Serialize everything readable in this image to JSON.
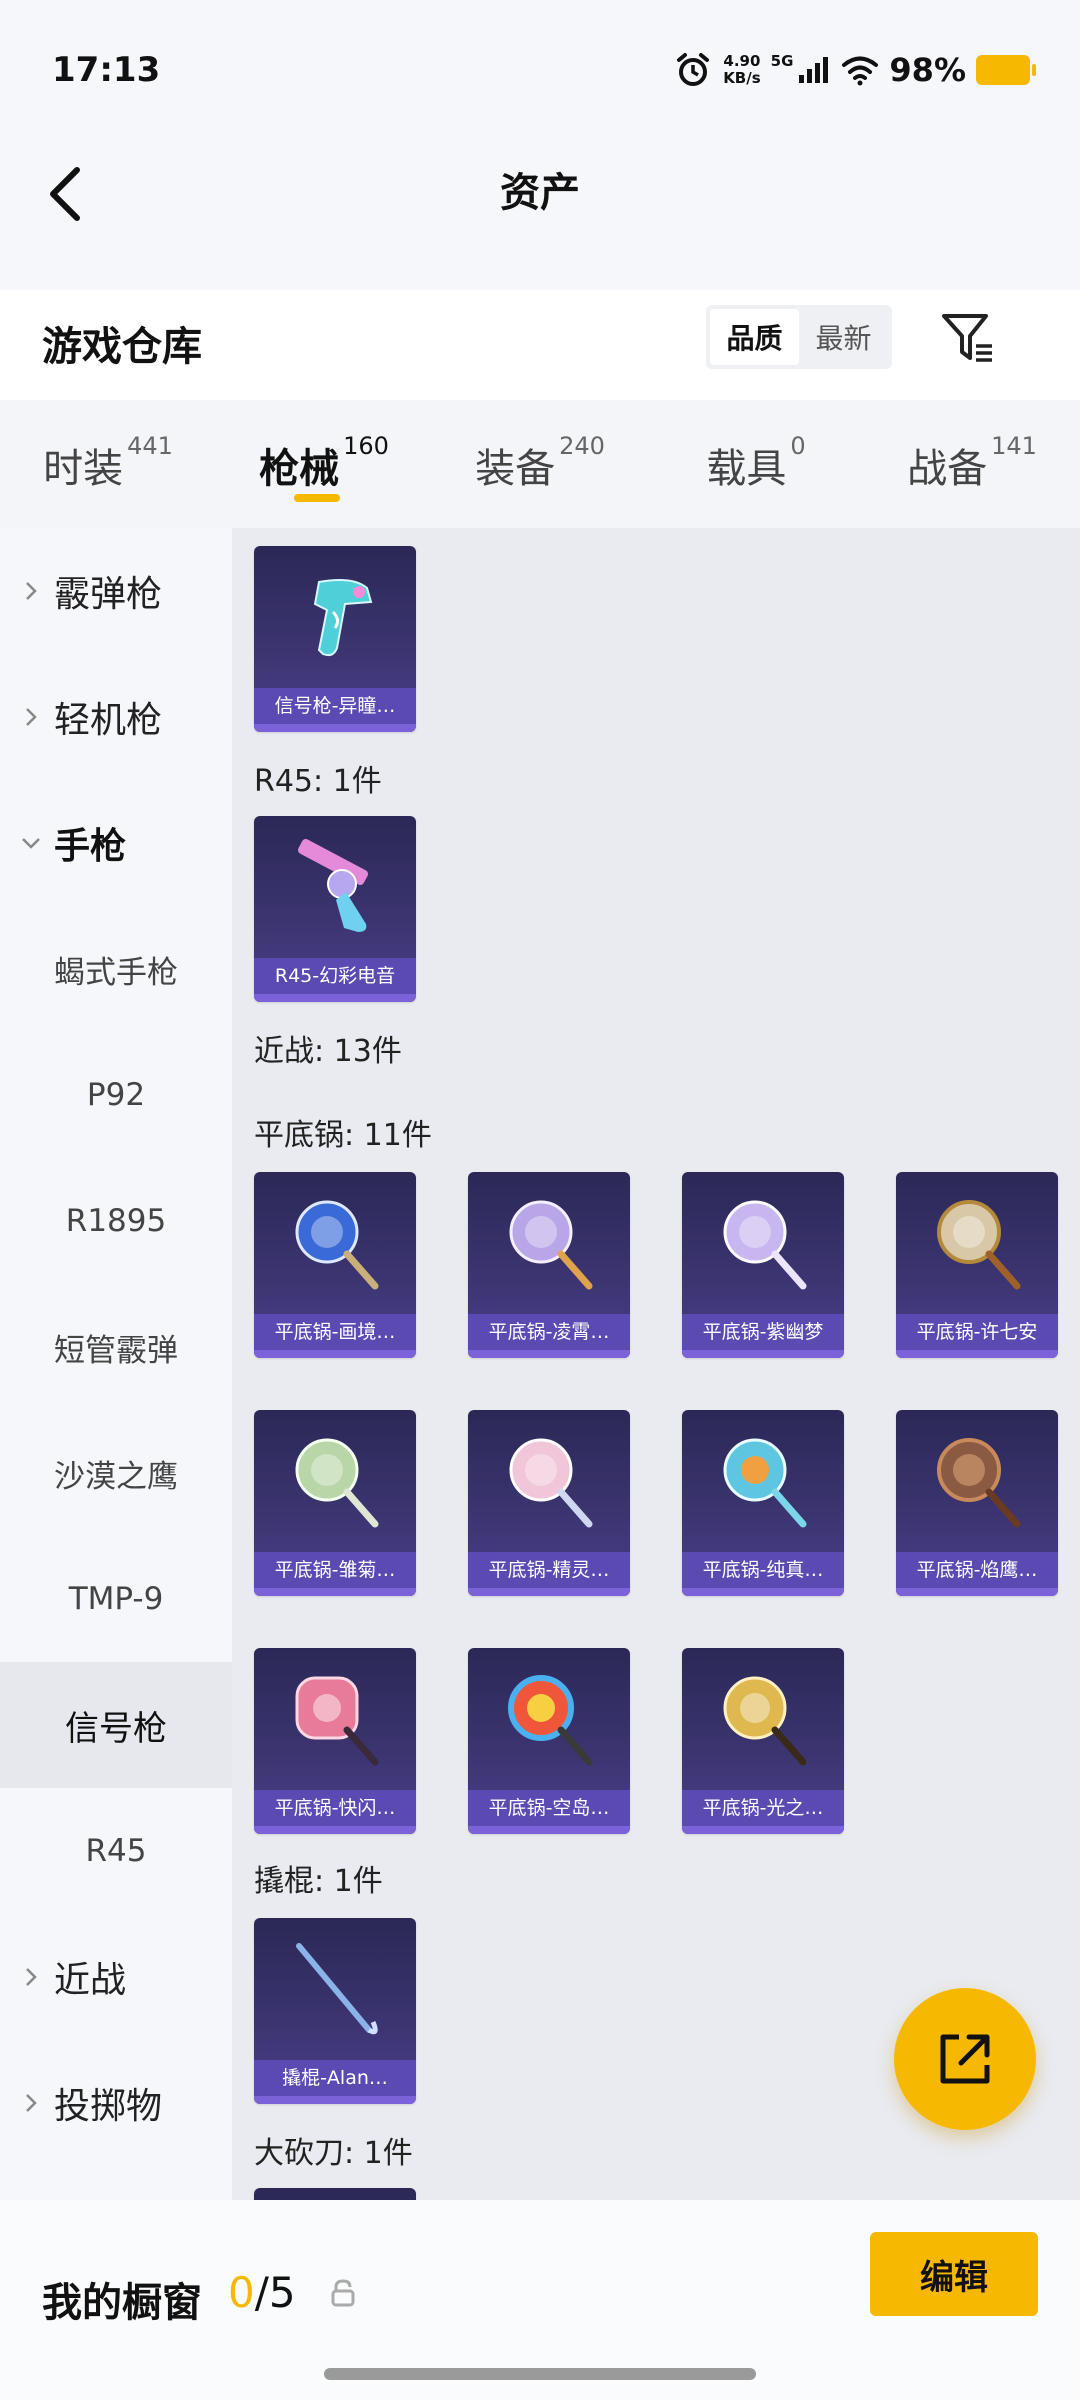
{
  "status_bar": {
    "time": "17:13",
    "net_speed_value": "4.90",
    "net_speed_unit": "KB/s",
    "network": "5G",
    "battery": "98%"
  },
  "nav": {
    "title": "资产"
  },
  "header": {
    "title": "游戏仓库",
    "sort_options": [
      "品质",
      "最新"
    ],
    "active_sort": "品质"
  },
  "tabs": [
    {
      "label": "时装",
      "count": "441"
    },
    {
      "label": "枪械",
      "count": "160",
      "active": true
    },
    {
      "label": "装备",
      "count": "240"
    },
    {
      "label": "载具",
      "count": "0"
    },
    {
      "label": "战备",
      "count": "141"
    }
  ],
  "sidebar": [
    {
      "label": "霰弹枪",
      "type": "category",
      "expanded": false
    },
    {
      "label": "轻机枪",
      "type": "category",
      "expanded": false
    },
    {
      "label": "手枪",
      "type": "category",
      "expanded": true
    },
    {
      "label": "蝎式手枪",
      "type": "sub"
    },
    {
      "label": "P92",
      "type": "sub"
    },
    {
      "label": "R1895",
      "type": "sub"
    },
    {
      "label": "短管霰弹",
      "type": "sub"
    },
    {
      "label": "沙漠之鹰",
      "type": "sub"
    },
    {
      "label": "TMP-9",
      "type": "sub"
    },
    {
      "label": "信号枪",
      "type": "sub",
      "selected": true
    },
    {
      "label": "R45",
      "type": "sub"
    },
    {
      "label": "近战",
      "type": "category",
      "expanded": false
    },
    {
      "label": "投掷物",
      "type": "category",
      "expanded": false
    }
  ],
  "sections": [
    "R45: 1件",
    "近战: 13件",
    "平底锅: 11件",
    "撬棍: 1件",
    "大砍刀: 1件"
  ],
  "items": [
    {
      "label": "信号枪-异瞳…",
      "icon": "flare-gun-icon",
      "accent": "#4fd0d8"
    },
    {
      "label": "R45-幻彩电音",
      "icon": "revolver-icon",
      "accent": "#e48ad8"
    },
    {
      "label": "平底锅-画境…",
      "icon": "pan-icon",
      "accent": "#3a6ad8"
    },
    {
      "label": "平底锅-凌霄…",
      "icon": "pan-icon",
      "accent": "#b9a6e8"
    },
    {
      "label": "平底锅-紫幽梦",
      "icon": "pan-icon",
      "accent": "#c8b6f0"
    },
    {
      "label": "平底锅-许七安",
      "icon": "pan-icon",
      "accent": "#d8c8a8"
    },
    {
      "label": "平底锅-雏菊…",
      "icon": "pan-icon",
      "accent": "#b8d6a8"
    },
    {
      "label": "平底锅-精灵…",
      "icon": "pan-icon",
      "accent": "#f0c6d8"
    },
    {
      "label": "平底锅-纯真…",
      "icon": "pan-icon",
      "accent": "#5ec6e0"
    },
    {
      "label": "平底锅-焰鹰…",
      "icon": "pan-icon",
      "accent": "#8a5a42"
    },
    {
      "label": "平底锅-快闪…",
      "icon": "pan-icon",
      "accent": "#e87a9a"
    },
    {
      "label": "平底锅-空岛…",
      "icon": "pan-icon",
      "accent": "#f0563a"
    },
    {
      "label": "平底锅-光之…",
      "icon": "pan-icon",
      "accent": "#e0b850"
    },
    {
      "label": "撬棍-Alan…",
      "icon": "crowbar-icon",
      "accent": "#8ab4e8"
    }
  ],
  "showcase": {
    "label": "我的橱窗",
    "used": "0",
    "sep_total": "/5",
    "edit_label": "编辑"
  },
  "colors": {
    "accent": "#f6b800",
    "card_label": "#5b4ab2"
  }
}
